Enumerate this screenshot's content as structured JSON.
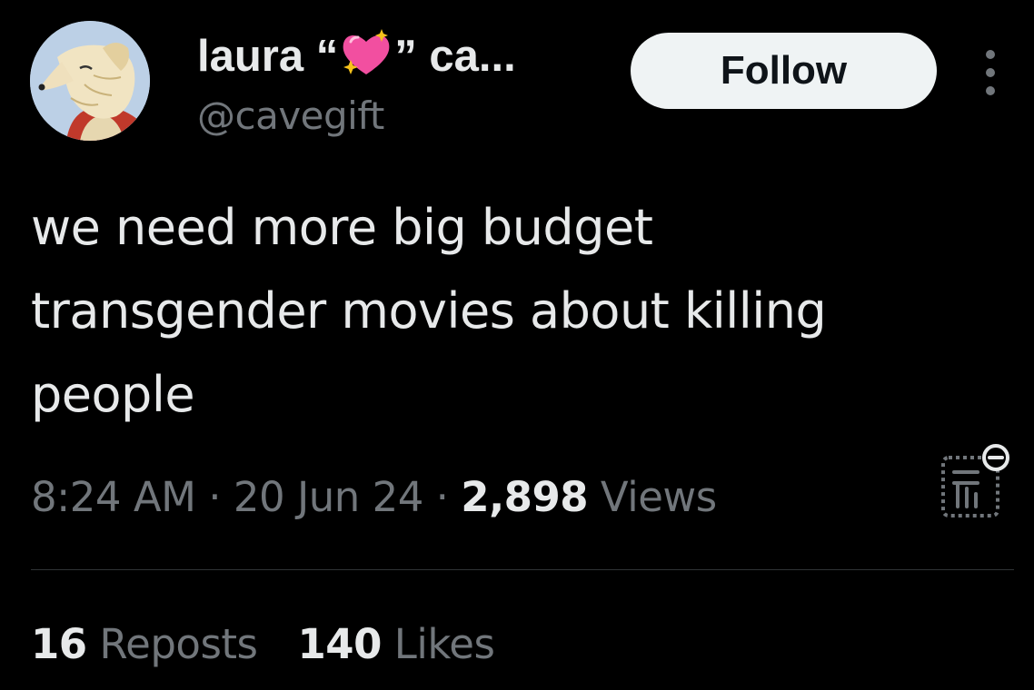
{
  "author": {
    "name_prefix": "laura “",
    "name_emoji": "sparkling-heart",
    "name_suffix": "” ca...",
    "handle": "@cavegift",
    "avatar": "borzoi-dog-illustration"
  },
  "actions": {
    "follow_label": "Follow",
    "more_icon": "more-vertical-icon"
  },
  "tweet": {
    "lines": [
      "we need more big budget",
      "transgender movies about killing",
      "people"
    ]
  },
  "meta": {
    "time": "8:24 AM",
    "separator": " · ",
    "date": "20 Jun 24",
    "views_count": "2,898",
    "views_label": " Views",
    "analytics_icon": "analytics-icon"
  },
  "engagement": {
    "reposts_count": "16",
    "reposts_label": " Reposts",
    "likes_count": "140",
    "likes_label": " Likes"
  },
  "colors": {
    "background": "#000000",
    "primary_text": "#e7e9ea",
    "secondary_text": "#71767b",
    "follow_bg": "#eff3f4",
    "heart_pink": "#f24fa0",
    "sparkle_yellow": "#f7c21b"
  }
}
